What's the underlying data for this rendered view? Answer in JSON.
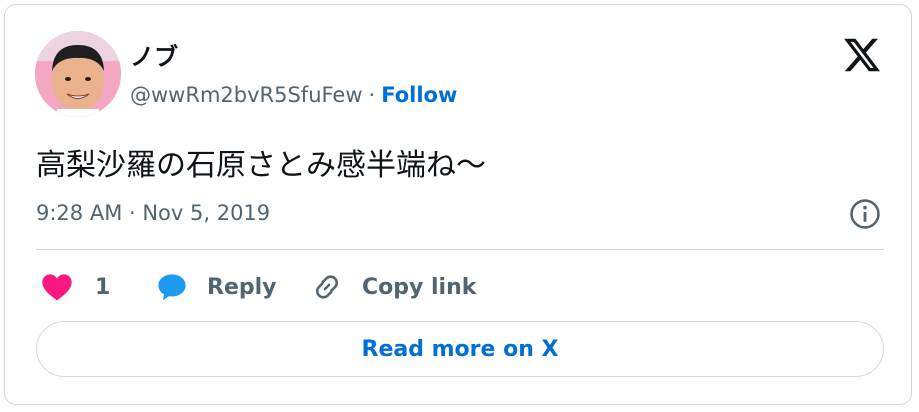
{
  "author": {
    "display_name": "ノブ",
    "handle": "@wwRm2bvR5SfuFew",
    "separator": "·",
    "follow_label": "Follow"
  },
  "tweet": {
    "text": "高梨沙羅の石原さとみ感半端ね〜",
    "timestamp": "9:28 AM · Nov 5, 2019"
  },
  "actions": {
    "like_count": "1",
    "reply_label": "Reply",
    "copy_link_label": "Copy link"
  },
  "read_more_label": "Read more on X",
  "icons": {
    "logo": "x-logo-icon",
    "info": "info-icon",
    "like": "heart-icon",
    "reply": "speech-bubble-icon",
    "copy": "link-icon"
  },
  "colors": {
    "accent": "#006fd6",
    "like": "#f91880",
    "reply": "#1d9bf0",
    "muted": "#536471",
    "border": "#cfd9de"
  }
}
